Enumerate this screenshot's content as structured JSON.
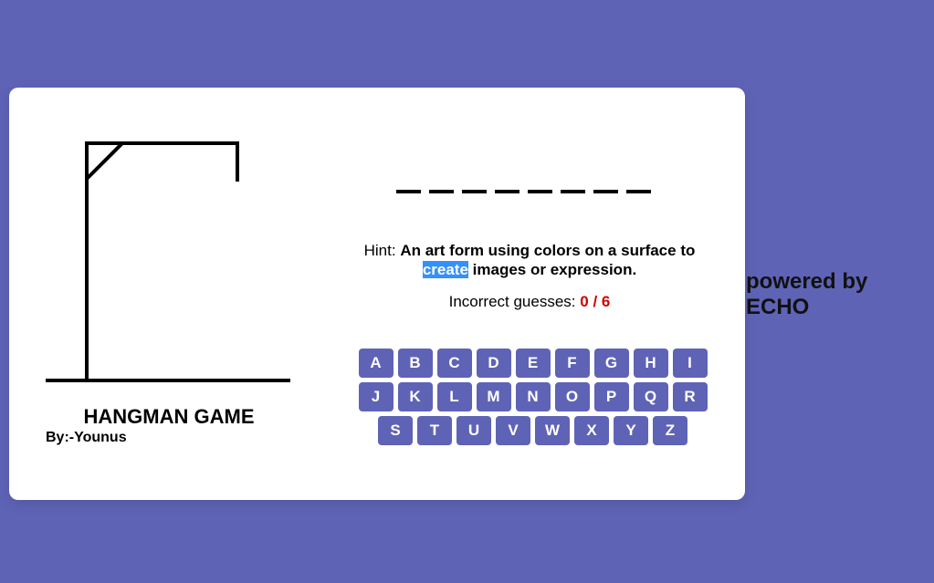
{
  "game": {
    "title": "HANGMAN GAME",
    "author": "By:-Younus",
    "word_blanks": [
      "_",
      "_",
      "_",
      "_",
      "_",
      "_",
      "_",
      "_"
    ],
    "hint_label": "Hint:",
    "hint_text_before": "An art form using colors on a surface to",
    "hint_selected_word": "create",
    "hint_text_after": "images or expression.",
    "incorrect_label": "Incorrect guesses:",
    "incorrect_count": "0 / 6"
  },
  "keyboard": {
    "keys": [
      "A",
      "B",
      "C",
      "D",
      "E",
      "F",
      "G",
      "H",
      "I",
      "J",
      "K",
      "L",
      "M",
      "N",
      "O",
      "P",
      "Q",
      "R",
      "S",
      "T",
      "U",
      "V",
      "W",
      "X",
      "Y",
      "Z"
    ]
  },
  "footer": {
    "powered_by": "powered by",
    "brand": "ECHO"
  },
  "colors": {
    "background": "#5e63b6",
    "key": "#5e63b6",
    "incorrect": "#d00000",
    "selection": "#3390ff"
  },
  "icons": {
    "gallows": "gallows-drawing"
  }
}
